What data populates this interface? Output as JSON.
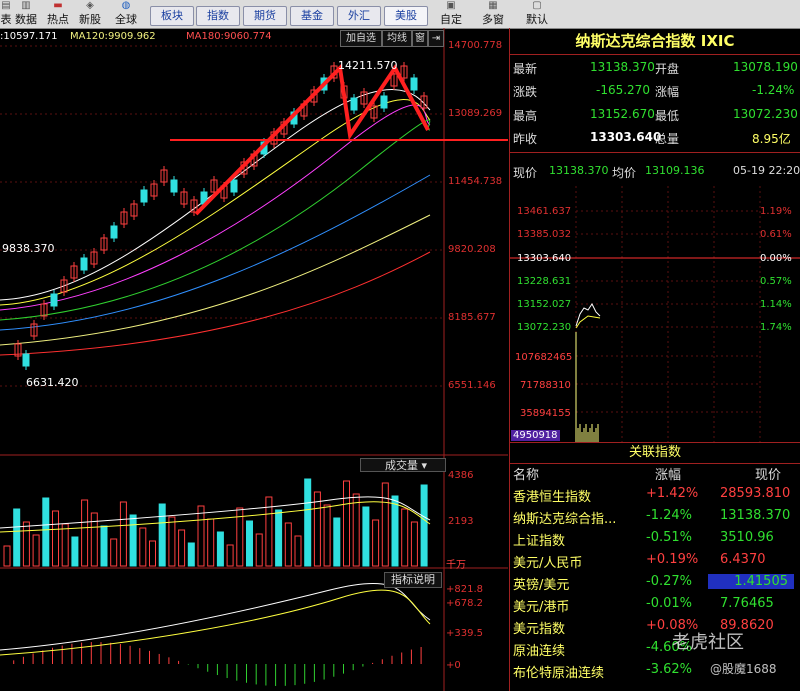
{
  "toolbar": {
    "icon_items": [
      {
        "label": "表",
        "icon": "table-icon"
      },
      {
        "label": "数据",
        "icon": "data-icon"
      },
      {
        "label": "热点",
        "icon": "hot-icon"
      },
      {
        "label": "新股",
        "icon": "new-icon"
      },
      {
        "label": "全球",
        "icon": "globe-icon"
      }
    ],
    "tabs": [
      "板块",
      "指数",
      "期货",
      "基金",
      "外汇",
      "美股"
    ],
    "right_items": [
      {
        "label": "自定",
        "icon": "custom-icon"
      },
      {
        "label": "多窗",
        "icon": "multi-window-icon"
      },
      {
        "label": "默认",
        "icon": "default-icon"
      }
    ]
  },
  "ma_legend": {
    "ma60": ":10597.171",
    "ma120_label": "MA120:",
    "ma120_value": "9909.962",
    "ma180_label": "MA180:",
    "ma180_value": "9060.774"
  },
  "chart_buttons": [
    "加自选",
    "均线",
    "窗",
    "⇥"
  ],
  "colors": {
    "up": "#ff4040",
    "down": "#30e0e0",
    "ma5": "#ffffff",
    "ma10": "#ffff40",
    "ma20": "#ff40ff",
    "ma30": "#30d030",
    "ma60": "#3090ff",
    "ma120": "#f0f080",
    "ma180": "#ff3030"
  },
  "kline": {
    "price_axis": [
      "14700.778",
      "13089.269",
      "11454.738",
      "9820.208",
      "8185.677",
      "6551.146"
    ],
    "left_label": "9838.370",
    "high_label": "14211.570",
    "low_label": "6631.420",
    "volume_label": "成交量",
    "volume_axis": [
      "4386",
      "2193"
    ],
    "volume_unit": "千万",
    "indicator_label": "指标说明",
    "macd_axis": [
      "+821.8",
      "+678.2",
      "+339.5",
      "+0"
    ]
  },
  "quote": {
    "title": "纳斯达克综合指数 IXIC",
    "latest_label": "最新",
    "latest": "13138.370",
    "open_label": "开盘",
    "open": "13078.190",
    "change_label": "涨跌",
    "change": "-165.270",
    "pct_label": "涨幅",
    "pct": "-1.24%",
    "high_label": "最高",
    "high": "13152.670",
    "low_label": "最低",
    "low": "13072.230",
    "prev_label": "昨收",
    "prev": "13303.640",
    "vol_label": "总量",
    "vol": "8.95亿"
  },
  "intraday": {
    "now_label": "现价",
    "now": "13138.370",
    "avg_label": "均价",
    "avg": "13109.136",
    "time": "05-19 22:20",
    "price_axis": [
      "13461.637",
      "13385.032",
      "13303.640",
      "13228.631",
      "13152.027",
      "13072.230"
    ],
    "pct_axis": [
      "1.19%",
      "0.61%",
      "0.00%",
      "0.57%",
      "1.14%",
      "1.74%"
    ],
    "vol_axis": [
      "107682465",
      "71788310",
      "35894155",
      "4950918"
    ]
  },
  "assoc": {
    "title": "关联指数",
    "col_name": "名称",
    "col_pct": "涨幅",
    "col_price": "现价",
    "rows": [
      {
        "name": "香港恒生指数",
        "pct": "+1.42%",
        "price": "28593.810"
      },
      {
        "name": "纳斯达克综合指...",
        "pct": "-1.24%",
        "price": "13138.370"
      },
      {
        "name": "上证指数",
        "pct": "-0.51%",
        "price": "3510.96"
      },
      {
        "name": "美元/人民币",
        "pct": "+0.19%",
        "price": "6.4370"
      },
      {
        "name": "英镑/美元",
        "pct": "-0.27%",
        "price": "1.41505"
      },
      {
        "name": "美元/港币",
        "pct": "-0.01%",
        "price": "7.76465"
      },
      {
        "name": "美元指数",
        "pct": "+0.08%",
        "price": "89.8620"
      },
      {
        "name": "原油连续",
        "pct": "-4.60%",
        "price": ""
      },
      {
        "name": "布伦特原油连续",
        "pct": "-3.62%",
        "price": ""
      }
    ]
  },
  "watermark": {
    "logo": "老虎社区",
    "user": "@股魔1688"
  }
}
